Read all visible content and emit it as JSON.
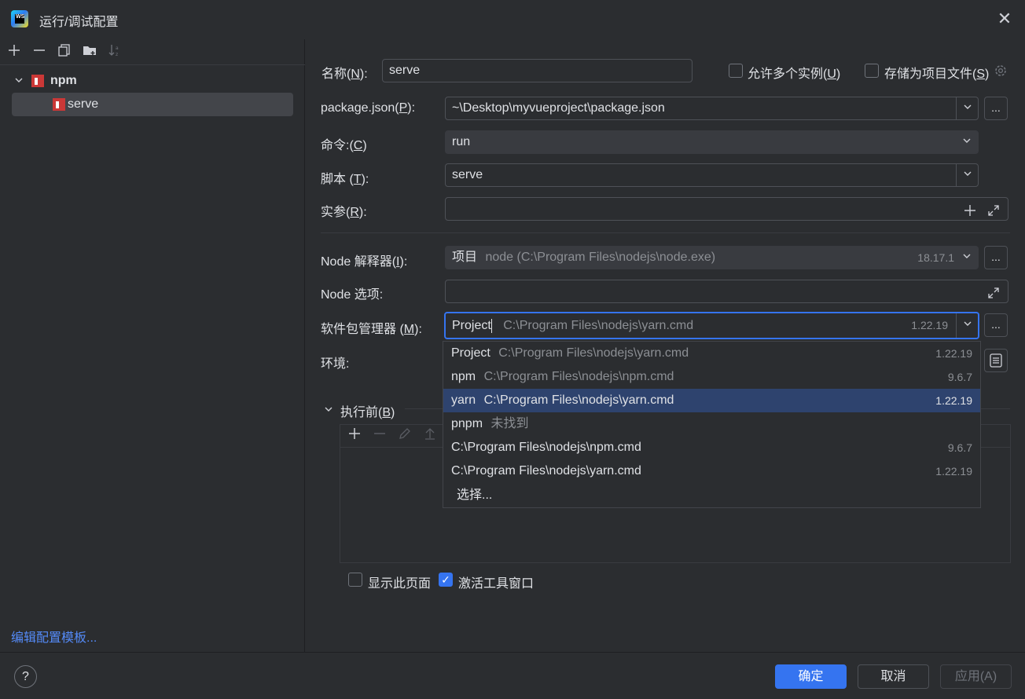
{
  "window": {
    "title": "运行/调试配置",
    "close_label": "✕"
  },
  "left": {
    "tree": {
      "group": "npm",
      "item": "serve"
    },
    "edit_templates": "编辑配置模板..."
  },
  "form": {
    "name_label": "名称(N):",
    "name_value": "serve",
    "allow_parallel_label": "允许多个实例(U)",
    "store_as_file_label": "存储为项目文件(S)",
    "package_json_label": "package.json(P):",
    "package_json_value": "~\\Desktop\\myvueproject\\package.json",
    "command_label": "命令:(C)",
    "command_value": "run",
    "scripts_label": "脚本 (T):",
    "scripts_value": "serve",
    "args_label": "实参(R):",
    "args_value": "",
    "node_interpreter_label": "Node 解释器(I):",
    "node_interpreter_prefix": "项目",
    "node_interpreter_path": "node (C:\\Program Files\\nodejs\\node.exe)",
    "node_interpreter_version": "18.17.1",
    "node_options_label": "Node 选项:",
    "node_options_value": "",
    "pkg_manager_label": "软件包管理器 (M):",
    "pkg_manager_value": "Project",
    "pkg_manager_path": "C:\\Program Files\\nodejs\\yarn.cmd",
    "pkg_manager_version": "1.22.19",
    "env_label": "环境:",
    "dots": "...",
    "before_launch_label": "执行前(B)",
    "show_page_label": "显示此页面",
    "activate_tool_label": "激活工具窗口"
  },
  "dropdown": {
    "items": [
      {
        "name": "Project",
        "path": "C:\\Program Files\\nodejs\\yarn.cmd",
        "version": "1.22.19"
      },
      {
        "name": "npm",
        "path": "C:\\Program Files\\nodejs\\npm.cmd",
        "version": "9.6.7"
      },
      {
        "name": "yarn",
        "path": "C:\\Program Files\\nodejs\\yarn.cmd",
        "version": "1.22.19"
      },
      {
        "name": "pnpm",
        "path": "未找到",
        "version": ""
      },
      {
        "name": "C:\\Program Files\\nodejs\\npm.cmd",
        "path": "",
        "version": "9.6.7"
      },
      {
        "name": "C:\\Program Files\\nodejs\\yarn.cmd",
        "path": "",
        "version": "1.22.19"
      }
    ],
    "select_label": "选择..."
  },
  "footer": {
    "help": "?",
    "ok": "确定",
    "cancel": "取消",
    "apply": "应用(A)"
  },
  "colors": {
    "accent": "#3574f0",
    "selected_row": "#2e436e",
    "link": "#548af7"
  }
}
